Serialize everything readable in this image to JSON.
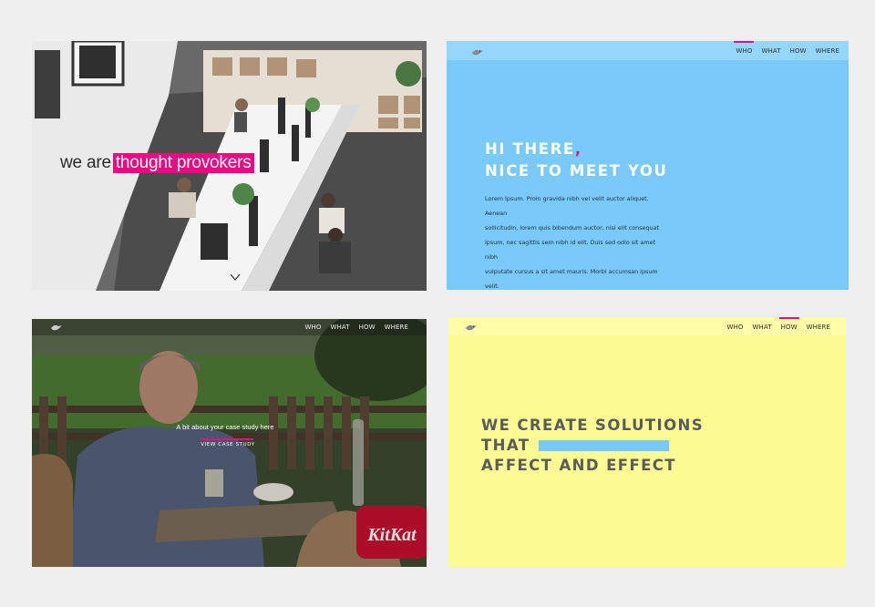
{
  "panel1": {
    "hero_prefix": "we are",
    "hero_highlight": "thought provokers",
    "icon": "chevron-down-icon"
  },
  "panel2": {
    "nav": [
      "WHO",
      "WHAT",
      "HOW",
      "WHERE"
    ],
    "active": "WHO",
    "title_line1": "HI THERE",
    "title_comma": ",",
    "title_line2": "NICE TO MEET YOU",
    "body_lines": [
      "Lorem Ipsum. Proin gravida nibh vel velit auctor aliquet. Aenean",
      "sollicitudin, lorem quis bibendum auctor, nisi elit consequat",
      "ipsum, nec sagittis sem nibh id elit. Duis sed odio sit amet nibh",
      "vulputate cursus a sit amet mauris. Morbi accumsan ipsum velit."
    ],
    "logo": "bird-logo-icon"
  },
  "panel3": {
    "nav": [
      "WHO",
      "WHAT",
      "HOW",
      "WHERE"
    ],
    "active": "WHAT",
    "case_text": "A bit about your case study here",
    "case_link": "VIEW CASE STUDY",
    "brand_logo": "KitKat"
  },
  "panel4": {
    "nav": [
      "WHO",
      "WHAT",
      "HOW",
      "WHERE"
    ],
    "active": "HOW",
    "title_line1": "WE CREATE SOLUTIONS",
    "title_line2": "THAT",
    "title_line3": "AFFECT AND EFFECT"
  },
  "colors": {
    "accent": "#ec0a83",
    "blue": "#79c9fb",
    "yellow": "#fcfb93",
    "background": "#efefef"
  }
}
